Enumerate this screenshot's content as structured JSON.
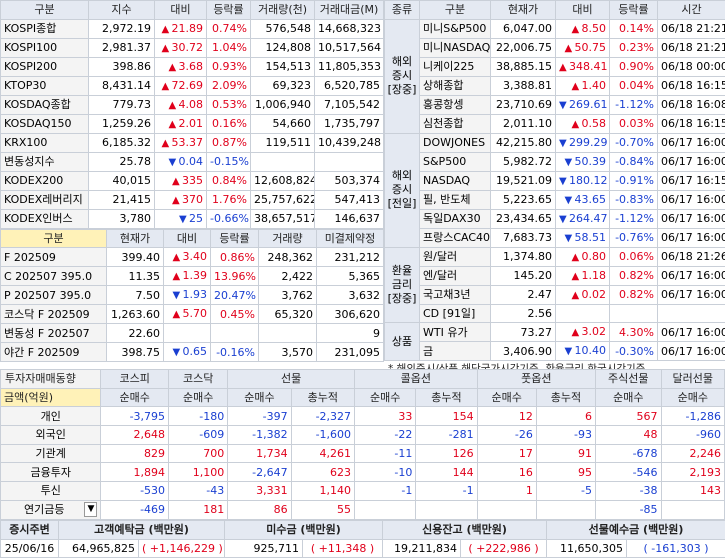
{
  "indices": {
    "headers": [
      "구분",
      "지수",
      "대비",
      "등락률",
      "거래량(천)",
      "거래대금(M)"
    ],
    "rows": [
      {
        "name": "KOSPI종합",
        "value": "2,972.19",
        "dir": "up",
        "change": "21.89",
        "rate": "0.74%",
        "volume": "576,548",
        "amount": "14,668,323"
      },
      {
        "name": "KOSPI100",
        "value": "2,981.37",
        "dir": "up",
        "change": "30.72",
        "rate": "1.04%",
        "volume": "124,808",
        "amount": "10,517,564"
      },
      {
        "name": "KOSPI200",
        "value": "398.86",
        "dir": "up",
        "change": "3.68",
        "rate": "0.93%",
        "volume": "154,513",
        "amount": "11,805,353"
      },
      {
        "name": "KTOP30",
        "value": "8,431.14",
        "dir": "up",
        "change": "72.69",
        "rate": "2.09%",
        "volume": "69,323",
        "amount": "6,520,785"
      },
      {
        "name": "KOSDAQ종합",
        "value": "779.73",
        "dir": "up",
        "change": "4.08",
        "rate": "0.53%",
        "volume": "1,006,940",
        "amount": "7,105,542"
      },
      {
        "name": "KOSDAQ150",
        "value": "1,259.26",
        "dir": "up",
        "change": "2.01",
        "rate": "0.16%",
        "volume": "54,660",
        "amount": "1,735,797"
      },
      {
        "name": "KRX100",
        "value": "6,185.32",
        "dir": "up",
        "change": "53.37",
        "rate": "0.87%",
        "volume": "119,511",
        "amount": "10,439,248"
      },
      {
        "name": "변동성지수",
        "value": "25.78",
        "dir": "dn",
        "change": "0.04",
        "rate": "-0.15%",
        "volume": "",
        "amount": ""
      },
      {
        "name": "KODEX200",
        "value": "40,015",
        "dir": "up",
        "change": "335",
        "rate": "0.84%",
        "volume": "12,608,824",
        "amount": "503,374"
      },
      {
        "name": "KODEX레버리지",
        "value": "21,415",
        "dir": "up",
        "change": "370",
        "rate": "1.76%",
        "volume": "25,757,622",
        "amount": "547,413"
      },
      {
        "name": "KODEX인버스",
        "value": "3,780",
        "dir": "dn",
        "change": "25",
        "rate": "-0.66%",
        "volume": "38,657,517",
        "amount": "146,637"
      }
    ]
  },
  "derivatives": {
    "headers": [
      "구분",
      "현재가",
      "대비",
      "등락률",
      "거래량",
      "미결제약정"
    ],
    "rows": [
      {
        "name": "F 202509",
        "value": "399.40",
        "dir": "up",
        "change": "3.40",
        "rate": "0.86%",
        "volume": "248,362",
        "oi": "231,212"
      },
      {
        "name": "C 202507 395.0",
        "value": "11.35",
        "dir": "up",
        "change": "1.39",
        "rate": "13.96%",
        "volume": "2,422",
        "oi": "5,365"
      },
      {
        "name": "P 202507 395.0",
        "value": "7.50",
        "dir": "dn",
        "change": "1.93",
        "rate": "20.47%",
        "volume": "3,762",
        "oi": "3,632"
      },
      {
        "name": "코스닥 F 202509",
        "value": "1,263.60",
        "dir": "up",
        "change": "5.70",
        "rate": "0.45%",
        "volume": "65,320",
        "oi": "306,620"
      },
      {
        "name": "변동성 F 202507",
        "value": "22.60",
        "dir": "",
        "change": "",
        "rate": "",
        "volume": "",
        "oi": "9"
      },
      {
        "name": "야간 F 202509",
        "value": "398.75",
        "dir": "dn",
        "change": "0.65",
        "rate": "-0.16%",
        "volume": "3,570",
        "oi": "231,095"
      }
    ]
  },
  "global": {
    "headers": [
      "종류",
      "구분",
      "현재가",
      "대비",
      "등락률",
      "시간"
    ],
    "groups": [
      {
        "label": "해외\n증시\n[장중]",
        "rows": [
          {
            "name": "미니S&P500",
            "value": "6,047.00",
            "dir": "up",
            "change": "8.50",
            "rate": "0.14%",
            "time": "06/18 21:21"
          },
          {
            "name": "미니NASDAQ",
            "value": "22,006.75",
            "dir": "up",
            "change": "50.75",
            "rate": "0.23%",
            "time": "06/18 21:21"
          },
          {
            "name": "니케이225",
            "value": "38,885.15",
            "dir": "up",
            "change": "348.41",
            "rate": "0.90%",
            "time": "06/18 00:00"
          },
          {
            "name": "상해종합",
            "value": "3,388.81",
            "dir": "up",
            "change": "1.40",
            "rate": "0.04%",
            "time": "06/18 16:15"
          },
          {
            "name": "홍콩항셍",
            "value": "23,710.69",
            "dir": "dn",
            "change": "269.61",
            "rate": "-1.12%",
            "time": "06/18 16:08"
          },
          {
            "name": "심천종합",
            "value": "2,011.10",
            "dir": "up",
            "change": "0.58",
            "rate": "0.03%",
            "time": "06/18 16:15"
          }
        ]
      },
      {
        "label": "해외\n증시\n[전일]",
        "rows": [
          {
            "name": "DOWJONES",
            "value": "42,215.80",
            "dir": "dn",
            "change": "299.29",
            "rate": "-0.70%",
            "time": "06/17 16:00"
          },
          {
            "name": "S&P500",
            "value": "5,982.72",
            "dir": "dn",
            "change": "50.39",
            "rate": "-0.84%",
            "time": "06/17 16:00"
          },
          {
            "name": "NASDAQ",
            "value": "19,521.09",
            "dir": "dn",
            "change": "180.12",
            "rate": "-0.91%",
            "time": "06/17 16:15"
          },
          {
            "name": "필, 반도체",
            "value": "5,223.65",
            "dir": "dn",
            "change": "43.65",
            "rate": "-0.83%",
            "time": "06/17 16:00"
          },
          {
            "name": "독일DAX30",
            "value": "23,434.65",
            "dir": "dn",
            "change": "264.47",
            "rate": "-1.12%",
            "time": "06/17 16:00"
          },
          {
            "name": "프랑스CAC40",
            "value": "7,683.73",
            "dir": "dn",
            "change": "58.51",
            "rate": "-0.76%",
            "time": "06/17 16:00"
          }
        ]
      },
      {
        "label": "환율\n금리\n[장중]",
        "rows": [
          {
            "name": "원/달러",
            "value": "1,374.80",
            "dir": "up",
            "change": "0.80",
            "rate": "0.06%",
            "time": "06/18 21:26"
          },
          {
            "name": "엔/달러",
            "value": "145.20",
            "dir": "up",
            "change": "1.18",
            "rate": "0.82%",
            "time": "06/17 16:00"
          },
          {
            "name": "국고채3년",
            "value": "2.47",
            "dir": "up",
            "change": "0.02",
            "rate": "0.82%",
            "time": "06/17 16:00"
          },
          {
            "name": "CD [91일]",
            "value": "2.56",
            "dir": "",
            "change": "",
            "rate": "",
            "time": ""
          }
        ]
      },
      {
        "label": "상품",
        "rows": [
          {
            "name": "WTI 유가",
            "value": "73.27",
            "dir": "up",
            "change": "3.02",
            "rate": "4.30%",
            "time": "06/17 16:00"
          },
          {
            "name": "금",
            "value": "3,406.90",
            "dir": "dn",
            "change": "10.40",
            "rate": "-0.30%",
            "time": "06/17 16:00"
          }
        ]
      }
    ],
    "note": "* 해외증시/상품 해당국가시간기준, 환율금리 한국시간기준"
  },
  "flows": {
    "title": "투자자매매동향",
    "unit": "금액(억원)",
    "groups": [
      "코스피",
      "코스닥",
      "선물",
      "콜옵션",
      "풋옵션",
      "주식선물",
      "달러선물"
    ],
    "subheaders": [
      "순매수",
      "순매수",
      "순매수",
      "총누적",
      "순매수",
      "총누적",
      "순매수",
      "총누적",
      "순매수",
      "순매수"
    ],
    "rows": [
      {
        "name": "개인",
        "values": [
          "-3,795",
          "-180",
          "-397",
          "-2,327",
          "33",
          "154",
          "12",
          "6",
          "567",
          "-1,286"
        ]
      },
      {
        "name": "외국인",
        "values": [
          "2,648",
          "-609",
          "-1,382",
          "-1,600",
          "-22",
          "-281",
          "-26",
          "-93",
          "48",
          "-960"
        ]
      },
      {
        "name": "기관계",
        "values": [
          "829",
          "700",
          "1,734",
          "4,261",
          "-11",
          "126",
          "17",
          "91",
          "-678",
          "2,246"
        ]
      },
      {
        "name": "금융투자",
        "values": [
          "1,894",
          "1,100",
          "-2,647",
          "623",
          "-10",
          "144",
          "16",
          "95",
          "-546",
          "2,193"
        ]
      },
      {
        "name": "투신",
        "values": [
          "-530",
          "-43",
          "3,331",
          "1,140",
          "-1",
          "-1",
          "1",
          "-5",
          "-38",
          "143"
        ]
      },
      {
        "name": "연기금등",
        "values": [
          "-469",
          "181",
          "86",
          "55",
          "",
          "",
          "",
          "",
          "-85",
          ""
        ]
      }
    ]
  },
  "deposit": {
    "headers": [
      "증시주변",
      "고객예탁금 (백만원)",
      "미수금 (백만원)",
      "신용잔고 (백만원)",
      "선물예수금 (백만원)"
    ],
    "date": "25/06/16",
    "items": [
      {
        "value": "64,965,825",
        "change": "( +1,146,229 )",
        "dir": "up"
      },
      {
        "value": "925,711",
        "change": "( +11,348 )",
        "dir": "up"
      },
      {
        "value": "19,211,834",
        "change": "( +222,986 )",
        "dir": "up"
      },
      {
        "value": "11,650,305",
        "change": "( -161,303 )",
        "dir": "dn"
      }
    ]
  },
  "colors": {
    "up": "#e0001b",
    "down": "#1a3fd1",
    "header": "#e4e9f2",
    "highlight": "#fff2b8"
  }
}
